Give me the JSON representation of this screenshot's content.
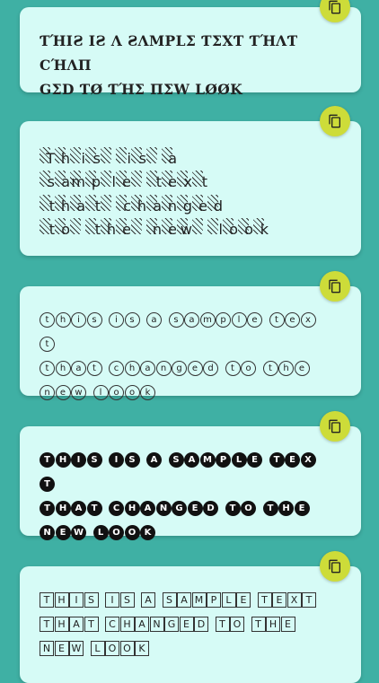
{
  "cards": [
    {
      "style": "stylized",
      "lines": [
        "ƬΉIƧ IƧ Λ ƧΛMPLΣ ƬΣXƬ ƬΉΛƬ CΉΛП",
        "GΣD ƬØ ƬΉΣ ПΣW LØØK"
      ]
    },
    {
      "style": "hatched",
      "lines": [
        "This is a",
        "sample text",
        "that changed",
        "to the new look"
      ]
    },
    {
      "style": "circled",
      "lines": [
        "this is a sample text",
        "that changed to the",
        "new look"
      ]
    },
    {
      "style": "negative-circled",
      "lines": [
        "THIS IS A SAMPLE TEXT",
        "THAT CHANGED TO THE",
        "NEW LOOK"
      ]
    },
    {
      "style": "squared",
      "lines": [
        "THIS IS A SAMPLE TEXT",
        "THAT CHANGED TO THE",
        "NEW LOOK"
      ]
    }
  ],
  "icons": {
    "copy": "copy-icon"
  },
  "colors": {
    "background": "#3fb0a4",
    "card": "#d6fbf6",
    "button": "#cddc39"
  }
}
